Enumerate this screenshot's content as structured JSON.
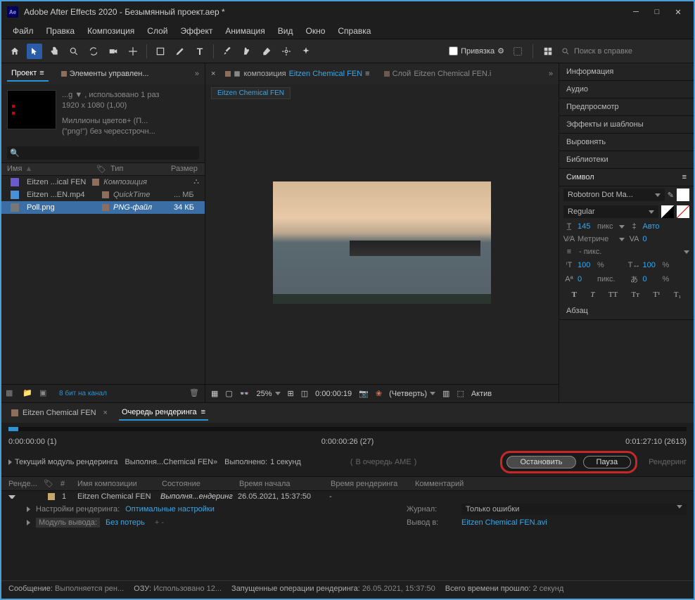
{
  "titlebar": {
    "app_icon": "Ae",
    "title": "Adobe After Effects 2020 - Безымянный проект.aep *"
  },
  "menu": [
    "Файл",
    "Правка",
    "Композиция",
    "Слой",
    "Эффект",
    "Анимация",
    "Вид",
    "Окно",
    "Справка"
  ],
  "toolbar": {
    "snap_label": "Привязка",
    "search_placeholder": "Поиск в справке"
  },
  "project_panel": {
    "tab_project": "Проект",
    "tab_controls": "Элементы управлен...",
    "info_line1": "...g ▼ , использовано 1 раз",
    "info_line2": "1920 x 1080 (1,00)",
    "info_line3": "Миллионы цветов+ (П...",
    "info_line4": "(\"png!\") без чересстрочн...",
    "col_name": "Имя",
    "col_type": "Тип",
    "col_size": "Размер",
    "rows": [
      {
        "name": "Eitzen ...ical FEN",
        "type": "Композиция",
        "size": ""
      },
      {
        "name": "Eitzen ...EN.mp4",
        "type": "QuickTime",
        "size": "... МБ"
      },
      {
        "name": "Poll.png",
        "type": "PNG-файл",
        "size": "34 КБ"
      }
    ],
    "footer_bit": "8 бит на канал"
  },
  "composition": {
    "tab_prefix": "композиция",
    "tab_name": "Eitzen Chemical FEN",
    "layer_tab_prefix": "Слой",
    "layer_tab_name": "Eitzen Chemical FEN.i",
    "layer_chip": "Eitzen Chemical FEN",
    "footer": {
      "zoom": "25%",
      "timecode": "0:00:00:19",
      "quality": "(Четверть)",
      "active": "Актив"
    }
  },
  "right_panel": {
    "sections": [
      "Информация",
      "Аудио",
      "Предпросмотр",
      "Эффекты и шаблоны",
      "Выровнять",
      "Библиотеки"
    ],
    "symbol": "Символ",
    "font": "Robotron Dot Ma...",
    "style": "Regular",
    "size_val": "145",
    "size_unit": "пикс",
    "lead_auto": "Авто",
    "kern_label": "Метриче",
    "track_val": "0",
    "line_unit": "- пикс.",
    "vscale": "100",
    "vscale_u": "%",
    "hscale": "100",
    "hscale_u": "%",
    "baseline": "0",
    "baseline_u": "пикс.",
    "tsume": "0",
    "tsume_u": "%",
    "paragraph": "Абзац"
  },
  "render_queue": {
    "tab_comp": "Eitzen Chemical FEN",
    "tab_queue": "Очередь рендеринга",
    "time_start": "0:00:00:00 (1)",
    "time_cur": "0:00:00:26 (27)",
    "time_end": "0:01:27:10 (2613)",
    "cur_module": "Текущий модуль рендеринга",
    "executing": "Выполня...Chemical FEN»",
    "done_label": "Выполнено:",
    "done_val": "1 секунд",
    "ame": "В очередь AME",
    "stop": "Остановить",
    "pause": "Пауза",
    "render_dim": "Рендеринг",
    "head": {
      "c1": "Ренде...",
      "c4": "Имя композиции",
      "c5": "Состояние",
      "c6": "Время начала",
      "c7": "Время рендеринга",
      "c8": "Комментарий"
    },
    "row": {
      "num": "1",
      "name": "Eitzen Chemical FEN",
      "state": "Выполня...ендеринг",
      "start": "26.05.2021, 15:37:50",
      "rt": "-"
    },
    "settings_lbl": "Настройки рендеринга:",
    "settings_val": "Оптимальные настройки",
    "journal_lbl": "Журнал:",
    "journal_val": "Только ошибки",
    "out_module_lbl": "Модуль вывода:",
    "out_module_val": "Без потерь",
    "out_to_lbl": "Вывод в:",
    "out_to_val": "Eitzen Chemical FEN.avi"
  },
  "status": {
    "msg_lbl": "Сообщение:",
    "msg": "Выполняется рен...",
    "ram_lbl": "ОЗУ:",
    "ram": "Использовано 12...",
    "ops_lbl": "Запущенные операции рендеринга:",
    "ops": "26.05.2021, 15:37:50",
    "elapsed_lbl": "Всего времени прошло:",
    "elapsed": "2 секунд"
  }
}
